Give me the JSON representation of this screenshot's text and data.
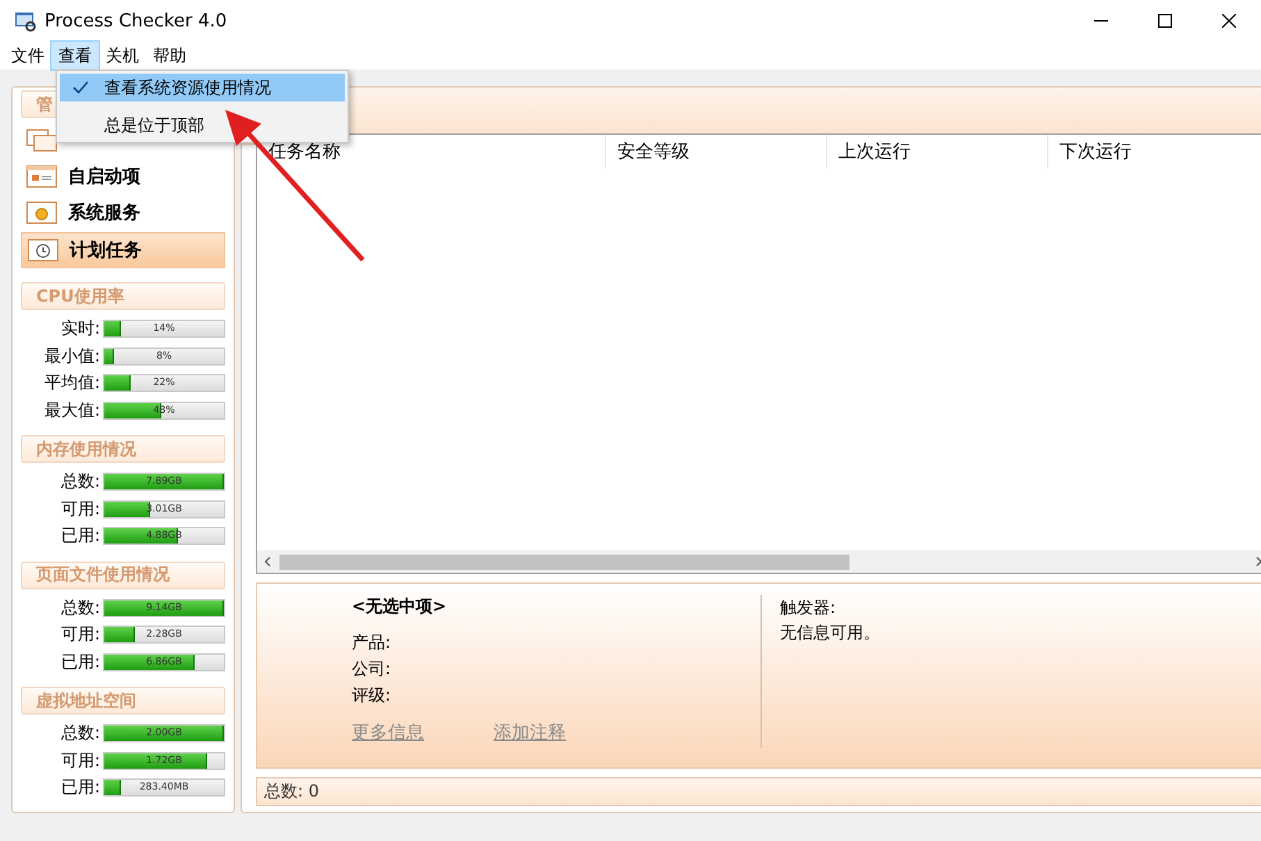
{
  "window": {
    "title": "Process Checker 4.0"
  },
  "menu_bar": [
    {
      "label": "文件",
      "selected": false
    },
    {
      "label": "查看",
      "selected": true
    },
    {
      "label": "关机",
      "selected": false
    },
    {
      "label": "帮助",
      "selected": false
    }
  ],
  "dropdown": [
    {
      "label": "查看系统资源使用情况",
      "checked": true,
      "selected": true
    },
    {
      "label": "总是位于顶部",
      "checked": false,
      "selected": false
    }
  ],
  "nav": {
    "header": "管",
    "items": [
      {
        "kind": "window",
        "selected": false
      },
      {
        "kind": "startup",
        "label": "自启动项",
        "selected": false
      },
      {
        "kind": "service",
        "label": "系统服务",
        "selected": false
      },
      {
        "kind": "schedule",
        "label": "计划任务",
        "selected": true
      }
    ]
  },
  "meter_groups": [
    {
      "title": "CPU使用率",
      "meters": [
        {
          "label": "实时:",
          "level": 0.14,
          "reading": "14%"
        },
        {
          "label": "最小值:",
          "level": 0.08,
          "reading": "8%"
        },
        {
          "label": "平均值:",
          "level": 0.22,
          "reading": "22%"
        },
        {
          "label": "最大值:",
          "level": 0.48,
          "reading": "48%"
        }
      ]
    },
    {
      "title": "内存使用情况",
      "meters": [
        {
          "label": "总数:",
          "level": 1,
          "reading": "7.89GB"
        },
        {
          "label": "可用:",
          "level": 0.38,
          "reading": "3.01GB"
        },
        {
          "label": "已用:",
          "level": 0.62,
          "reading": "4.88GB"
        }
      ]
    },
    {
      "title": "页面文件使用情况",
      "meters": [
        {
          "label": "总数:",
          "level": 1,
          "reading": "9.14GB"
        },
        {
          "label": "可用:",
          "level": 0.25,
          "reading": "2.28GB"
        },
        {
          "label": "已用:",
          "level": 0.75,
          "reading": "6.86GB"
        }
      ]
    },
    {
      "title": "虚拟地址空间",
      "meters": [
        {
          "label": "总数:",
          "level": 1,
          "reading": "2.00GB"
        },
        {
          "label": "可用:",
          "level": 0.86,
          "reading": "1.72GB"
        },
        {
          "label": "已用:",
          "level": 0.14,
          "reading": "283.40MB"
        }
      ]
    }
  ],
  "table": {
    "columns": [
      "任务名称",
      "安全等级",
      "上次运行",
      "下次运行"
    ]
  },
  "details": {
    "title": "<无选中项>",
    "fields": [
      "产品:",
      "公司:",
      "评级:"
    ],
    "links": [
      "更多信息",
      "添加注释"
    ],
    "trigger_label": "触发器:",
    "trigger_text": "无信息可用。"
  },
  "status_bar": "总数: 0"
}
